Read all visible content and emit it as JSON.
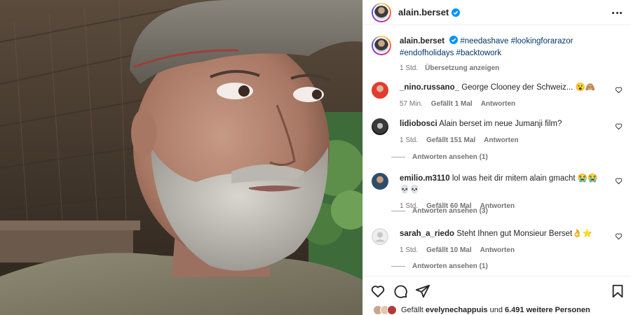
{
  "post": {
    "username": "alain.berset",
    "caption": {
      "username": "alain.berset",
      "hashtags": "#needashave #lookingforarazor #endofholidays #backtowork",
      "time": "1 Std.",
      "translate": "Übersetzung anzeigen"
    },
    "comments": [
      {
        "username": "_nino.russano_",
        "text": "George Clooney der Schweiz... 😮🙈",
        "time": "57 Min.",
        "likes": "Gefällt 1 Mal",
        "reply": "Antworten",
        "view_replies": ""
      },
      {
        "username": "lidiobosci",
        "text": "Alain berset im neue Jumanji film?",
        "time": "1 Std.",
        "likes": "Gefällt 151 Mal",
        "reply": "Antworten",
        "view_replies": "Antworten ansehen (1)"
      },
      {
        "username": "emilio.m3110",
        "text": "lol was heit dir mitem alain gmacht 😭😭💀💀",
        "time": "1 Std.",
        "likes": "Gefällt 60 Mal",
        "reply": "Antworten",
        "view_replies": "Antworten ansehen (3)"
      },
      {
        "username": "sarah_a_riedo",
        "text": "Steht Ihnen gut Monsieur Berset👌⭐",
        "time": "1 Std.",
        "likes": "Gefällt 10 Mal",
        "reply": "Antworten",
        "view_replies": "Antworten ansehen (1)"
      }
    ],
    "likes_line": {
      "prefix": "Gefällt",
      "user": "evelynechappuis",
      "middle": "und",
      "others": "6.491 weitere Personen"
    }
  },
  "colors": {
    "verified": "#0095f6",
    "hashtag": "#00376b",
    "meta": "#737373"
  },
  "icons": [
    "verified-badge-icon",
    "more-options-icon",
    "heart-icon",
    "comment-icon",
    "share-icon",
    "bookmark-icon"
  ]
}
